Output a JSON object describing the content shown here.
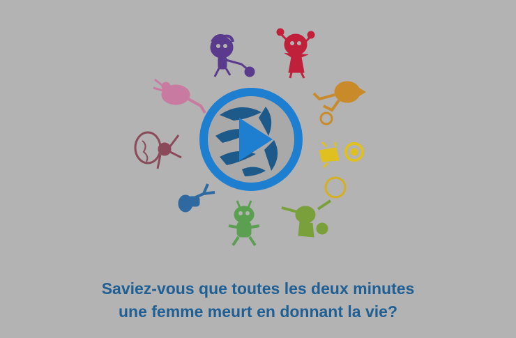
{
  "video": {
    "caption_line1": "Saviez-vous que toutes les deux minutes",
    "caption_line2": "une femme meurt en donnant la vie?",
    "play_icon": "play-icon"
  },
  "colors": {
    "background": "#b3b3b3",
    "play_ring": "#1e7fd1",
    "play_triangle": "#1e7fd1",
    "emblem": "#1d5a8a",
    "caption": "#1f5f93",
    "figures": [
      "#5a3a8c",
      "#c0203a",
      "#c98a2a",
      "#e0c020",
      "#d4b020",
      "#7aa03c",
      "#5aa050",
      "#2e6aa0",
      "#8a4a5a",
      "#c87aa0"
    ]
  },
  "figures": [
    {
      "name": "purple-child-figure"
    },
    {
      "name": "red-child-figure"
    },
    {
      "name": "orange-child-figure"
    },
    {
      "name": "yellow-child-figure"
    },
    {
      "name": "yellow-circle-figure"
    },
    {
      "name": "olive-child-figure"
    },
    {
      "name": "green-child-figure"
    },
    {
      "name": "blue-child-figure"
    },
    {
      "name": "maroon-child-figure"
    },
    {
      "name": "pink-child-figure"
    }
  ]
}
